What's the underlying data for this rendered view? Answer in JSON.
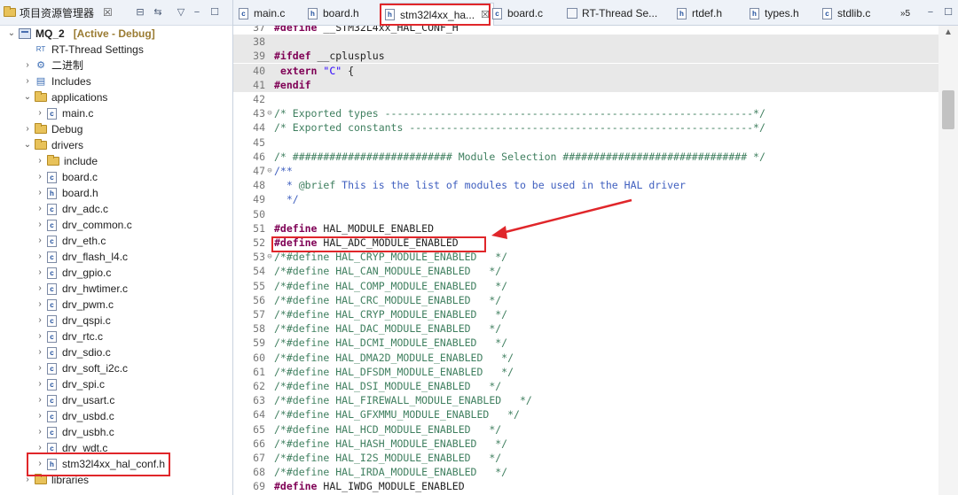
{
  "explorer": {
    "title": "项目资源管理器",
    "close": "☒",
    "tree": [
      {
        "label": "MQ_2",
        "tag": "[Active - Debug]",
        "type": "project",
        "twisty": "⌄"
      },
      {
        "label": "RT-Thread Settings",
        "type": "settings",
        "twisty": ""
      },
      {
        "label": "二进制",
        "type": "binaries",
        "twisty": "›"
      },
      {
        "label": "Includes",
        "type": "includes",
        "twisty": "›"
      },
      {
        "label": "applications",
        "type": "folder",
        "twisty": "⌄"
      },
      {
        "label": "main.c",
        "type": "c",
        "twisty": "›"
      },
      {
        "label": "Debug",
        "type": "folder",
        "twisty": "›"
      },
      {
        "label": "drivers",
        "type": "folder",
        "twisty": "⌄"
      },
      {
        "label": "include",
        "type": "folder",
        "twisty": "›"
      },
      {
        "label": "board.c",
        "type": "c",
        "twisty": "›"
      },
      {
        "label": "board.h",
        "type": "h",
        "twisty": "›"
      },
      {
        "label": "drv_adc.c",
        "type": "c",
        "twisty": "›"
      },
      {
        "label": "drv_common.c",
        "type": "c",
        "twisty": "›"
      },
      {
        "label": "drv_eth.c",
        "type": "c",
        "twisty": "›"
      },
      {
        "label": "drv_flash_l4.c",
        "type": "c",
        "twisty": "›"
      },
      {
        "label": "drv_gpio.c",
        "type": "c",
        "twisty": "›"
      },
      {
        "label": "drv_hwtimer.c",
        "type": "c",
        "twisty": "›"
      },
      {
        "label": "drv_pwm.c",
        "type": "c",
        "twisty": "›"
      },
      {
        "label": "drv_qspi.c",
        "type": "c",
        "twisty": "›"
      },
      {
        "label": "drv_rtc.c",
        "type": "c",
        "twisty": "›"
      },
      {
        "label": "drv_sdio.c",
        "type": "c",
        "twisty": "›"
      },
      {
        "label": "drv_soft_i2c.c",
        "type": "c",
        "twisty": "›"
      },
      {
        "label": "drv_spi.c",
        "type": "c",
        "twisty": "›"
      },
      {
        "label": "drv_usart.c",
        "type": "c",
        "twisty": "›"
      },
      {
        "label": "drv_usbd.c",
        "type": "c",
        "twisty": "›"
      },
      {
        "label": "drv_usbh.c",
        "type": "c",
        "twisty": "›"
      },
      {
        "label": "drv_wdt.c",
        "type": "c",
        "twisty": "›"
      },
      {
        "label": "stm32l4xx_hal_conf.h",
        "type": "h",
        "twisty": "›"
      },
      {
        "label": "libraries",
        "type": "folder",
        "twisty": "›"
      }
    ]
  },
  "tabs": [
    {
      "label": "main.c",
      "type": "c"
    },
    {
      "label": "board.h",
      "type": "h"
    },
    {
      "label": "stm32l4xx_ha...",
      "type": "h",
      "active": true,
      "close": "☒"
    },
    {
      "label": "board.c",
      "type": "c"
    },
    {
      "label": "RT-Thread Se...",
      "type": "rt"
    },
    {
      "label": "rtdef.h",
      "type": "h"
    },
    {
      "label": "types.h",
      "type": "h"
    },
    {
      "label": "stdlib.c",
      "type": "c"
    }
  ],
  "tab_overflow": "»5",
  "code": [
    {
      "n": "37",
      "parts": [
        [
          "kw",
          "#define"
        ],
        [
          "tx",
          " __STM32L4xx_HAL_CONF_H"
        ]
      ]
    },
    {
      "n": "38",
      "parts": [],
      "hl": true
    },
    {
      "n": "39",
      "parts": [
        [
          "kw",
          "#ifdef"
        ],
        [
          "tx",
          " __cplusplus"
        ]
      ],
      "hl": true
    },
    {
      "n": "40",
      "parts": [
        [
          "tx",
          " "
        ],
        [
          "kw",
          "extern"
        ],
        [
          "tx",
          " "
        ],
        [
          "st",
          "\"C\""
        ],
        [
          "tx",
          " {"
        ]
      ],
      "hl": true
    },
    {
      "n": "41",
      "parts": [
        [
          "kw",
          "#endif"
        ]
      ],
      "hl": true
    },
    {
      "n": "42",
      "parts": []
    },
    {
      "n": "43",
      "fold": "⊖",
      "parts": [
        [
          "cm",
          "/* Exported types ------------------------------------------------------------*/"
        ]
      ]
    },
    {
      "n": "44",
      "parts": [
        [
          "cm",
          "/* Exported constants --------------------------------------------------------*/"
        ]
      ]
    },
    {
      "n": "45",
      "parts": []
    },
    {
      "n": "46",
      "parts": [
        [
          "cm",
          "/* ########################## Module Selection ############################## */"
        ]
      ]
    },
    {
      "n": "47",
      "fold": "⊖",
      "parts": [
        [
          "dc",
          "/**"
        ]
      ]
    },
    {
      "n": "48",
      "parts": [
        [
          "dc",
          "  * "
        ],
        [
          "cm",
          "@brief"
        ],
        [
          "dc",
          " This is the list of modules to be used in the HAL driver"
        ]
      ]
    },
    {
      "n": "49",
      "parts": [
        [
          "dc",
          "  */"
        ]
      ]
    },
    {
      "n": "50",
      "parts": []
    },
    {
      "n": "51",
      "parts": [
        [
          "kw",
          "#define"
        ],
        [
          "tx",
          " HAL_MODULE_ENABLED"
        ]
      ]
    },
    {
      "n": "52",
      "parts": [
        [
          "kw",
          "#define"
        ],
        [
          "tx",
          " HAL_ADC_MODULE_ENABLED"
        ]
      ]
    },
    {
      "n": "53",
      "fold": "⊖",
      "parts": [
        [
          "cm",
          "/*#define HAL_CRYP_MODULE_ENABLED   */"
        ]
      ]
    },
    {
      "n": "54",
      "parts": [
        [
          "cm",
          "/*#define HAL_CAN_MODULE_ENABLED   */"
        ]
      ]
    },
    {
      "n": "55",
      "parts": [
        [
          "cm",
          "/*#define HAL_COMP_MODULE_ENABLED   */"
        ]
      ]
    },
    {
      "n": "56",
      "parts": [
        [
          "cm",
          "/*#define HAL_CRC_MODULE_ENABLED   */"
        ]
      ]
    },
    {
      "n": "57",
      "parts": [
        [
          "cm",
          "/*#define HAL_CRYP_MODULE_ENABLED   */"
        ]
      ]
    },
    {
      "n": "58",
      "parts": [
        [
          "cm",
          "/*#define HAL_DAC_MODULE_ENABLED   */"
        ]
      ]
    },
    {
      "n": "59",
      "parts": [
        [
          "cm",
          "/*#define HAL_DCMI_MODULE_ENABLED   */"
        ]
      ]
    },
    {
      "n": "60",
      "parts": [
        [
          "cm",
          "/*#define HAL_DMA2D_MODULE_ENABLED   */"
        ]
      ]
    },
    {
      "n": "61",
      "parts": [
        [
          "cm",
          "/*#define HAL_DFSDM_MODULE_ENABLED   */"
        ]
      ]
    },
    {
      "n": "62",
      "parts": [
        [
          "cm",
          "/*#define HAL_DSI_MODULE_ENABLED   */"
        ]
      ]
    },
    {
      "n": "63",
      "parts": [
        [
          "cm",
          "/*#define HAL_FIREWALL_MODULE_ENABLED   */"
        ]
      ]
    },
    {
      "n": "64",
      "parts": [
        [
          "cm",
          "/*#define HAL_GFXMMU_MODULE_ENABLED   */"
        ]
      ]
    },
    {
      "n": "65",
      "parts": [
        [
          "cm",
          "/*#define HAL_HCD_MODULE_ENABLED   */"
        ]
      ]
    },
    {
      "n": "66",
      "parts": [
        [
          "cm",
          "/*#define HAL_HASH_MODULE_ENABLED   */"
        ]
      ]
    },
    {
      "n": "67",
      "parts": [
        [
          "cm",
          "/*#define HAL_I2S_MODULE_ENABLED   */"
        ]
      ]
    },
    {
      "n": "68",
      "parts": [
        [
          "cm",
          "/*#define HAL_IRDA_MODULE_ENABLED   */"
        ]
      ]
    },
    {
      "n": "69",
      "parts": [
        [
          "kw",
          "#define"
        ],
        [
          "tx",
          " HAL_IWDG_MODULE_ENABLED"
        ]
      ]
    }
  ],
  "colors": {
    "annotation": "#e0262a",
    "keyword": "#7f0055",
    "comment": "#3f7f5f",
    "string": "#2a00ff"
  }
}
